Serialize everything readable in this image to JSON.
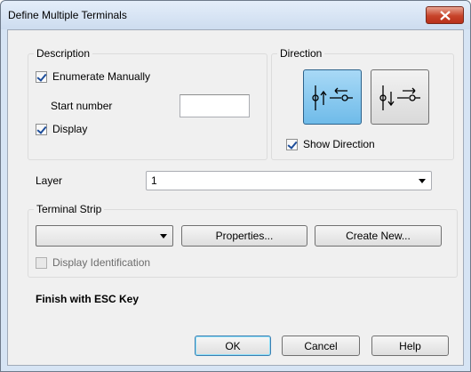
{
  "window": {
    "title": "Define Multiple Terminals"
  },
  "description": {
    "group_label": "Description",
    "enumerate_manually": {
      "label": "Enumerate Manually",
      "checked": true
    },
    "start_number": {
      "label": "Start number",
      "value": ""
    },
    "display": {
      "label": "Display",
      "checked": true
    }
  },
  "direction": {
    "group_label": "Direction",
    "buttons": [
      {
        "name": "direction-in",
        "active": true
      },
      {
        "name": "direction-out",
        "active": false
      }
    ],
    "show_direction": {
      "label": "Show Direction",
      "checked": true
    }
  },
  "layer": {
    "label": "Layer",
    "value": "1"
  },
  "terminal_strip": {
    "group_label": "Terminal Strip",
    "selected": "",
    "properties_label": "Properties...",
    "create_new_label": "Create New...",
    "display_identification": {
      "label": "Display Identification",
      "checked": false,
      "enabled": false
    }
  },
  "hint": "Finish with ESC Key",
  "footer": {
    "ok_label": "OK",
    "cancel_label": "Cancel",
    "help_label": "Help"
  },
  "colors": {
    "active_toggle": "#6fbbe9",
    "close_button": "#c7432a",
    "title_bar": "#cddcef"
  }
}
